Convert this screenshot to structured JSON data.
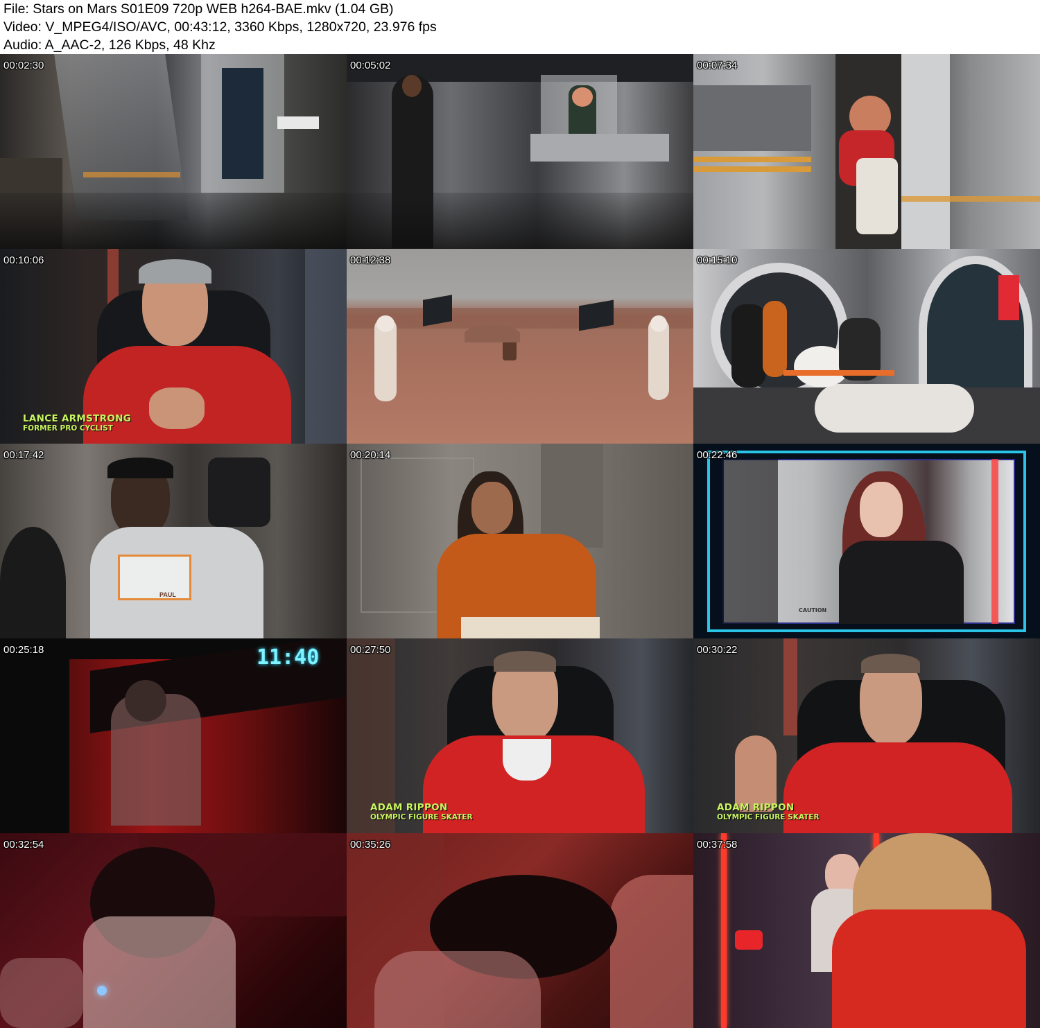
{
  "header": {
    "file_line": "File: Stars on Mars S01E09 720p WEB h264-BAE.mkv (1.04 GB)",
    "video_line": "Video: V_MPEG4/ISO/AVC, 00:43:12, 3360 Kbps, 1280x720, 23.976 fps",
    "audio_line": "Audio: A_AAC-2, 126 Kbps, 48 Khz"
  },
  "thumbnails": [
    {
      "timestamp": "00:02:30"
    },
    {
      "timestamp": "00:05:02"
    },
    {
      "timestamp": "00:07:34"
    },
    {
      "timestamp": "00:10:06",
      "lower_third": {
        "name": "LANCE ARMSTRONG",
        "role": "FORMER PRO CYCLIST"
      }
    },
    {
      "timestamp": "00:12:38"
    },
    {
      "timestamp": "00:15:10"
    },
    {
      "timestamp": "00:17:42",
      "badge": "PAUL"
    },
    {
      "timestamp": "00:20:14"
    },
    {
      "timestamp": "00:22:46",
      "caption": "CAUTION"
    },
    {
      "timestamp": "00:25:18",
      "clock": "11:40"
    },
    {
      "timestamp": "00:27:50",
      "lower_third": {
        "name": "ADAM RIPPON",
        "role": "OLYMPIC FIGURE SKATER"
      }
    },
    {
      "timestamp": "00:30:22",
      "lower_third": {
        "name": "ADAM RIPPON",
        "role": "OLYMPIC FIGURE SKATER"
      }
    },
    {
      "timestamp": "00:32:54"
    },
    {
      "timestamp": "00:35:26"
    },
    {
      "timestamp": "00:37:58"
    }
  ],
  "colors": {
    "lower_third_text": "#c8f560",
    "clock_text": "#7ff3ff",
    "hud_frame": "#2fd8ff"
  }
}
